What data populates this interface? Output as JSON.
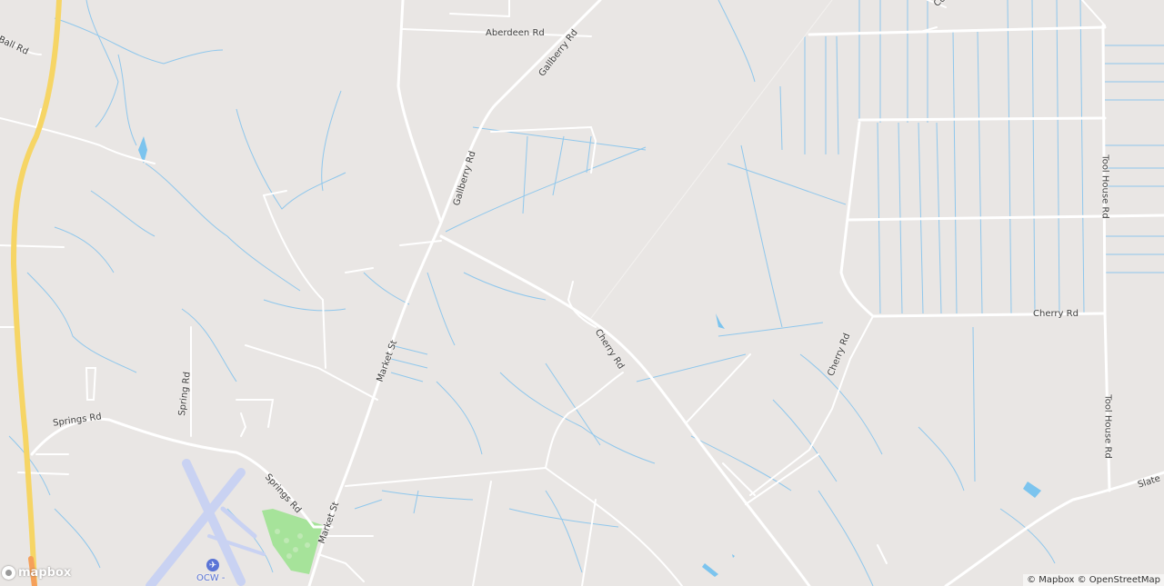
{
  "map": {
    "road_labels": {
      "aberdeen_rd": "Aberdeen Rd",
      "gallberry_rd_north": "Gallberry Rd",
      "gallberry_rd_south": "Gallberry Rd",
      "ball_rd": "Ball Rd",
      "co_rd": "Co",
      "tool_house_rd_north": "Tool House Rd",
      "tool_house_rd_south": "Tool House Rd",
      "cherry_rd_east": "Cherry Rd",
      "cherry_rd_center": "Cherry Rd",
      "cherry_rd_diag": "Cherry Rd",
      "market_st_north": "Market St",
      "market_st_south": "Market St",
      "spring_rd": "Spring Rd",
      "springs_rd_west": "Springs Rd",
      "springs_rd_south": "Springs Rd",
      "slate_rd": "Slate"
    },
    "poi": {
      "airport_label": "OCW -",
      "airport_icon": "airplane-icon"
    },
    "colors": {
      "land": "#e9e6e4",
      "road": "#ffffff",
      "water": "#7cc4ee",
      "highway": "#f6d565",
      "park": "#a6e39a",
      "runway": "#c9d2f2"
    }
  },
  "branding": {
    "logo_text": "mapbox",
    "attribution": "© Mapbox © OpenStreetMap"
  }
}
